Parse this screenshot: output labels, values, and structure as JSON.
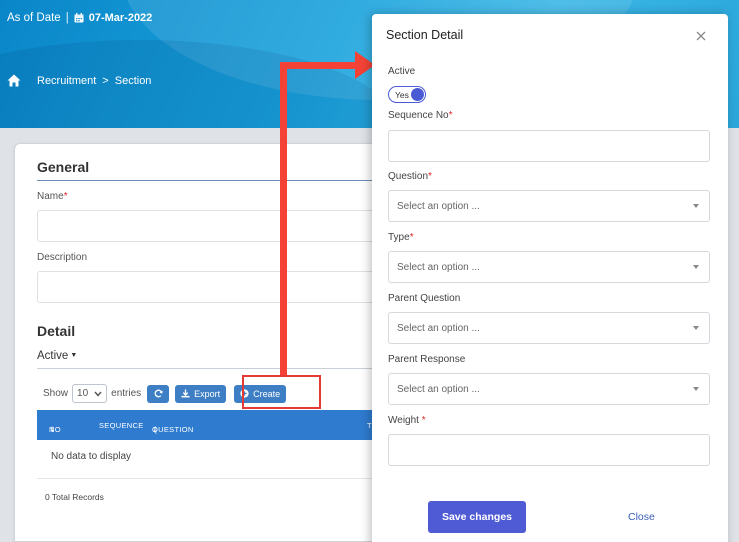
{
  "header": {
    "as_of_label": "As of Date",
    "separator": "|",
    "date": "07-Mar-2022",
    "breadcrumb": [
      "Recruitment",
      "Section"
    ],
    "breadcrumb_sep": ">"
  },
  "general": {
    "title": "General",
    "name_label": "Name",
    "description_label": "Description"
  },
  "detail": {
    "title": "Detail",
    "filter_label": "Active",
    "show_label": "Show",
    "page_size": "10",
    "entries_label": "entries",
    "export_label": "Export",
    "create_label": "Create",
    "columns": [
      "NO",
      "SEQUENCE",
      "QUESTION",
      "T"
    ],
    "empty_text": "No data to display",
    "total_text": "0 Total Records"
  },
  "modal": {
    "title": "Section Detail",
    "active_label": "Active",
    "active_value": "Yes",
    "sequence_label": "Sequence No",
    "question_label": "Question",
    "type_label": "Type",
    "parent_question_label": "Parent Question",
    "parent_response_label": "Parent Response",
    "weight_label": "Weight ",
    "select_placeholder": "Select an option ...",
    "save_label": "Save changes",
    "close_label": "Close",
    "required_mark": "*"
  },
  "colors": {
    "primary": "#4f5bd5",
    "table_header": "#2f7bd0",
    "annotation": "#f44336"
  },
  "icons": [
    "calendar-icon",
    "home-icon",
    "refresh-icon",
    "export-icon",
    "plus-circle-icon",
    "close-icon",
    "chevron-down-icon",
    "sort-icon"
  ]
}
